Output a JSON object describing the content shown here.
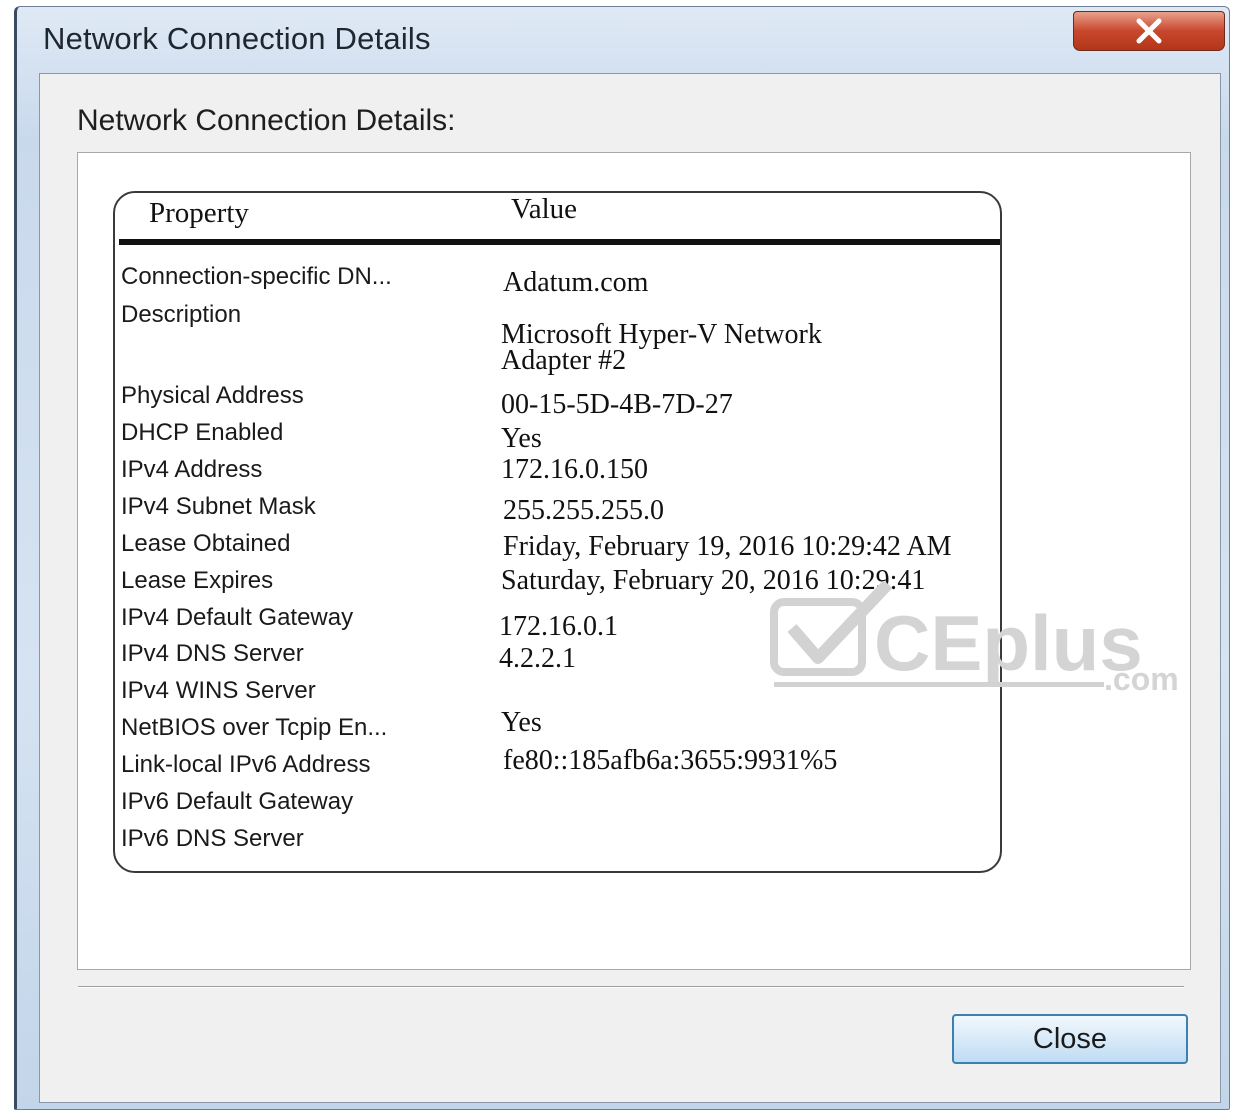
{
  "window": {
    "title": "Network Connection Details"
  },
  "section_label": "Network Connection Details:",
  "table": {
    "headers": {
      "property": "Property",
      "value": "Value"
    },
    "rows": [
      {
        "property": "Connection-specific DN...",
        "value": "Adatum.com"
      },
      {
        "property": "Description",
        "value": "Microsoft Hyper-V Network Adapter #2"
      },
      {
        "property": "Physical Address",
        "value": "00-15-5D-4B-7D-27"
      },
      {
        "property": "DHCP Enabled",
        "value": "Yes"
      },
      {
        "property": "IPv4 Address",
        "value": "172.16.0.150"
      },
      {
        "property": "IPv4 Subnet Mask",
        "value": "255.255.255.0"
      },
      {
        "property": "Lease Obtained",
        "value": "Friday, February 19, 2016 10:29:42 AM"
      },
      {
        "property": "Lease Expires",
        "value": "Saturday, February 20, 2016 10:29:41"
      },
      {
        "property": "IPv4 Default Gateway",
        "value": "172.16.0.1"
      },
      {
        "property": "IPv4 DNS Server",
        "value": "4.2.2.1"
      },
      {
        "property": "IPv4 WINS Server",
        "value": ""
      },
      {
        "property": "NetBIOS over Tcpip En...",
        "value": "Yes"
      },
      {
        "property": "Link-local IPv6 Address",
        "value": "fe80::185afb6a:3655:9931%5"
      },
      {
        "property": "IPv6 Default Gateway",
        "value": ""
      },
      {
        "property": "IPv6 DNS Server",
        "value": ""
      }
    ]
  },
  "buttons": {
    "close_label": "Close"
  },
  "watermark": {
    "text": "CEplus",
    "suffix": ".com"
  },
  "icons": {
    "title_close": "close-x-icon",
    "watermark_check": "checkmark-icon"
  },
  "colors": {
    "title_close_bg": "#c8472d",
    "close_button_border": "#3c7fb1",
    "watermark": "#d2d2d2"
  }
}
